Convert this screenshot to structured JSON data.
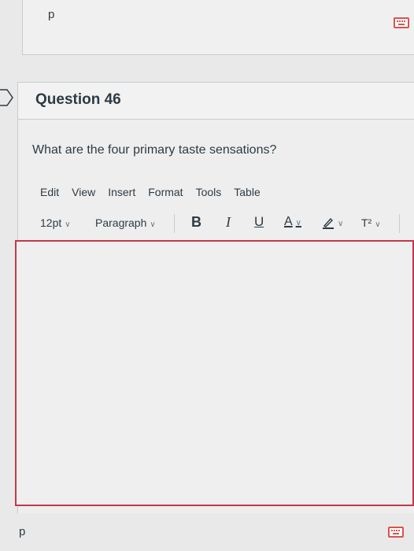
{
  "previous_answer": {
    "text": "p"
  },
  "question": {
    "title": "Question 46",
    "text": "What are the four primary taste sensations?"
  },
  "editor": {
    "menu": [
      "Edit",
      "View",
      "Insert",
      "Format",
      "Tools",
      "Table"
    ],
    "font_size": "12pt",
    "block_format": "Paragraph",
    "bold": "B",
    "italic": "I",
    "underline": "U",
    "text_color": "A",
    "superscript": "T²",
    "border_color": "#c2384a",
    "content": ""
  },
  "footer": {
    "text": "p"
  },
  "icons": {
    "keyboard": "keyboard-icon",
    "flag": "question-flag-icon",
    "highlight": "highlight-pen-icon"
  }
}
